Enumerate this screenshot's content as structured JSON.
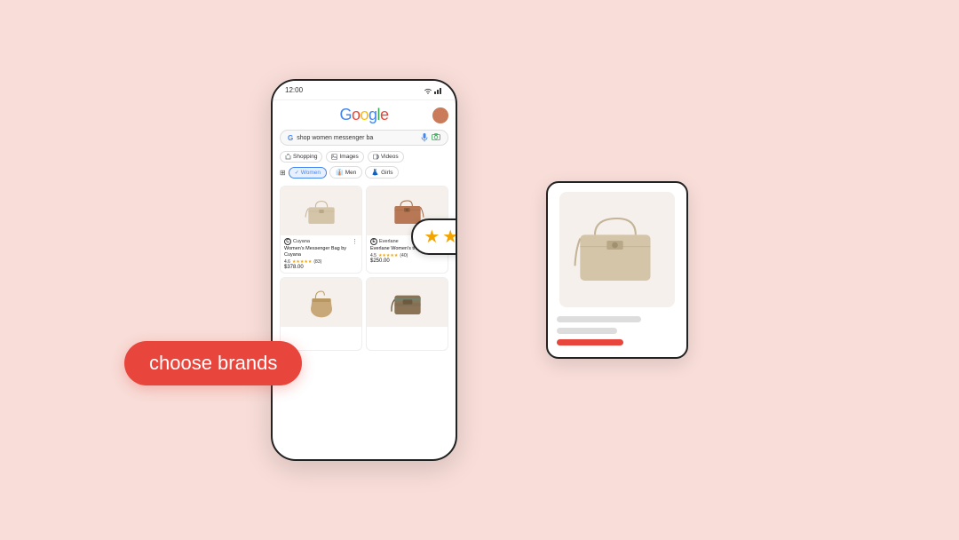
{
  "scene": {
    "background_color": "#f8ddd8"
  },
  "phone": {
    "status_bar": {
      "time": "12:00",
      "signal": "wifi+bars"
    },
    "google_logo": "Google",
    "search_query": "shop women messenger ba",
    "filter_tabs": [
      {
        "label": "Shopping",
        "active": false
      },
      {
        "label": "Images",
        "active": false
      },
      {
        "label": "Videos",
        "active": false
      }
    ],
    "category_tabs": [
      {
        "label": "Women",
        "selected": true
      },
      {
        "label": "Men",
        "selected": false
      },
      {
        "label": "Girls",
        "selected": false
      }
    ],
    "products": [
      {
        "brand": "Cuyana",
        "brand_letter": "C",
        "title": "Women's Messenger Bag by Cuyana",
        "rating": "4.6",
        "reviews": "(83)",
        "price": "$378.00",
        "bag_color": "#d4c4a8"
      },
      {
        "brand": "Everlane",
        "brand_letter": "E",
        "title": "Everlane Women's the Form bag",
        "rating": "4.5",
        "reviews": "(40)",
        "price": "$250.00",
        "bag_color": "#b87856"
      },
      {
        "brand": "",
        "title": "",
        "price": "",
        "bag_color": "#c8a878"
      },
      {
        "brand": "",
        "title": "",
        "price": "",
        "bag_color": "#8b7355"
      }
    ]
  },
  "stars_tooltip": {
    "stars": [
      "★",
      "★",
      "★",
      "★",
      "★"
    ]
  },
  "choose_brands_button": {
    "label": "choose brands"
  },
  "detail_card": {
    "bag_color": "#d4c4a8"
  }
}
